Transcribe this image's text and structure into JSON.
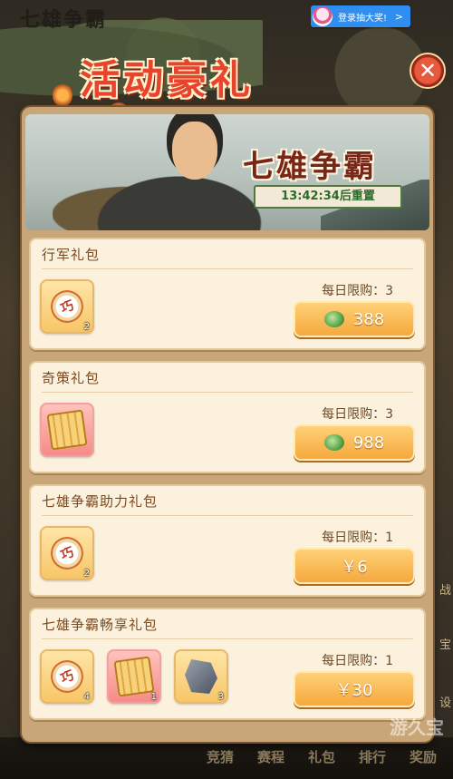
{
  "background": {
    "title": "七雄争霸",
    "bottom_tabs": [
      "竞猜",
      "赛程",
      "礼包",
      "排行",
      "奖励"
    ],
    "side_buttons": [
      "战",
      "宝",
      "设"
    ]
  },
  "notification": {
    "text": "登录抽大奖!",
    "chevron": ">"
  },
  "dialog": {
    "title": "活动豪礼",
    "close_icon": "close-icon",
    "banner": {
      "title": "七雄争霸",
      "timer": "13:42:34后重置"
    }
  },
  "gifts": [
    {
      "name": "行军礼包",
      "limit": "每日限购：3",
      "price": "388",
      "currency": "jade",
      "items": [
        {
          "art": "scroll",
          "bg": "gold",
          "count": "2"
        }
      ]
    },
    {
      "name": "奇策礼包",
      "limit": "每日限购：3",
      "price": "988",
      "currency": "jade",
      "items": [
        {
          "art": "book",
          "bg": "pink",
          "count": ""
        }
      ]
    },
    {
      "name": "七雄争霸助力礼包",
      "limit": "每日限购：1",
      "price": "￥6",
      "currency": "rmb",
      "items": [
        {
          "art": "scroll",
          "bg": "gold",
          "count": "2"
        }
      ]
    },
    {
      "name": "七雄争霸畅享礼包",
      "limit": "每日限购：1",
      "price": "￥30",
      "currency": "rmb",
      "items": [
        {
          "art": "scroll",
          "bg": "gold",
          "count": "4"
        },
        {
          "art": "book",
          "bg": "pink",
          "count": "1"
        },
        {
          "art": "ore",
          "bg": "gold",
          "count": "3"
        }
      ]
    }
  ],
  "scroll_glyph": "巧",
  "watermark": "游久宝"
}
